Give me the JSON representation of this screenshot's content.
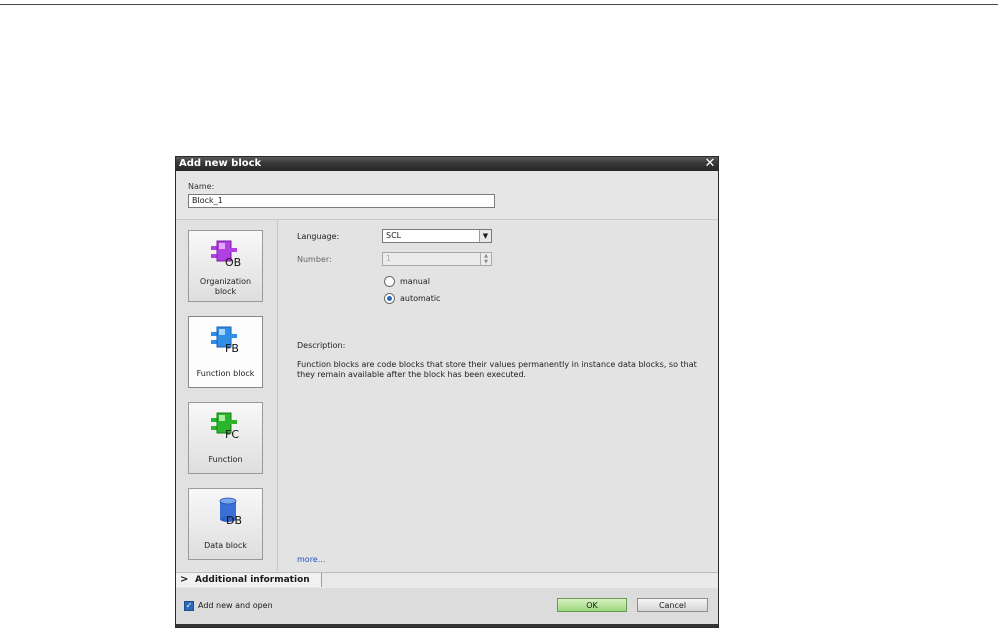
{
  "dialog": {
    "title": "Add new block",
    "close_glyph": "✕"
  },
  "name": {
    "label": "Name:",
    "value": "Block_1"
  },
  "blocks": [
    {
      "label": "Organization block",
      "icon": "ob-icon",
      "icon_text": "OB",
      "color": "#b040e0",
      "selected": false
    },
    {
      "label": "Function block",
      "icon": "fb-icon",
      "icon_text": "FB",
      "color": "#2f8ee8",
      "selected": true
    },
    {
      "label": "Function",
      "icon": "fc-icon",
      "icon_text": "FC",
      "color": "#2bb52b",
      "selected": false
    },
    {
      "label": "Data block",
      "icon": "db-icon",
      "icon_text": "DB",
      "color": "#3a6fd8",
      "selected": false
    }
  ],
  "settings": {
    "language_label": "Language:",
    "language_value": "SCL",
    "number_label": "Number:",
    "number_value": "1",
    "radio_manual": "manual",
    "radio_automatic": "automatic",
    "selected_radio": "automatic"
  },
  "description": {
    "label": "Description:",
    "text": "Function blocks are code blocks that store their values permanently in instance data blocks, so that they remain available after the block has been executed.",
    "more": "more..."
  },
  "additional": {
    "label": "Additional  information"
  },
  "footer": {
    "checkbox_label": "Add new and open",
    "checkbox_checked": true,
    "ok": "OK",
    "cancel": "Cancel"
  }
}
